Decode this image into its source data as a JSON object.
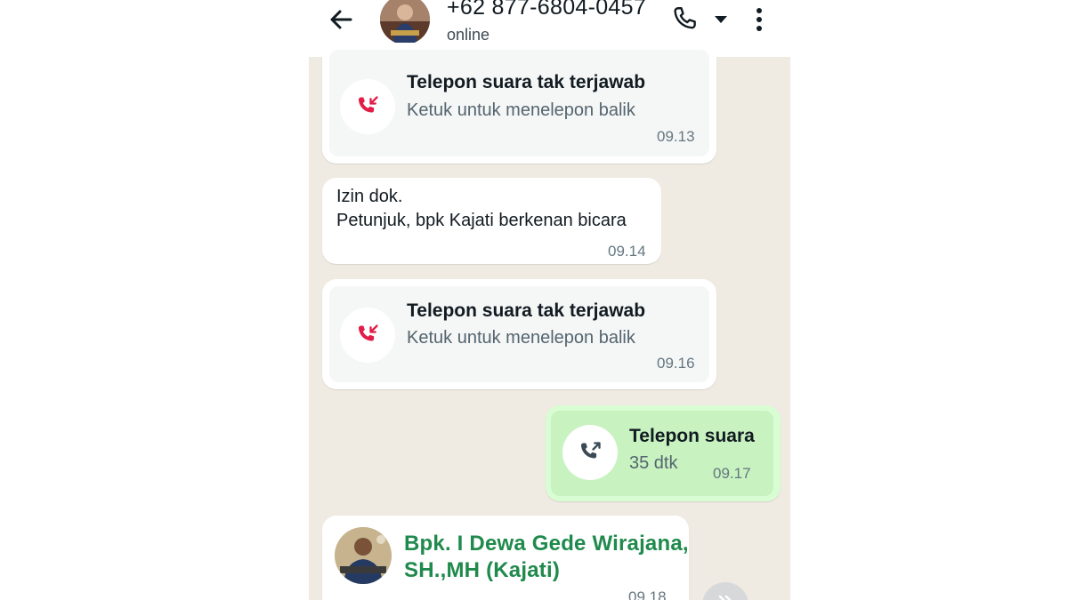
{
  "header": {
    "contact_name": "+62 877-6804-0457",
    "status": "online"
  },
  "messages": [
    {
      "kind": "missed-call",
      "title": "Telepon suara tak terjawab",
      "subtitle": "Ketuk untuk menelepon balik",
      "time": "09.13"
    },
    {
      "kind": "text",
      "lines": [
        "Izin dok.",
        "Petunjuk, bpk Kajati berkenan bicara"
      ],
      "time": "09.14"
    },
    {
      "kind": "missed-call",
      "title": "Telepon suara tak terjawab",
      "subtitle": "Ketuk untuk menelepon balik",
      "time": "09.16"
    },
    {
      "kind": "outgoing-call",
      "title": "Telepon suara",
      "subtitle": "35 dtk",
      "time": "09.17"
    },
    {
      "kind": "contact-card",
      "name_lines": [
        "Bpk. I Dewa Gede Wirajana,",
        "SH.,MH (Kajati)"
      ],
      "time": "09.18"
    }
  ],
  "colors": {
    "chat_background": "#efeae2",
    "incoming_bubble": "#ffffff",
    "outgoing_bubble": "#d9fdd3",
    "missed_call_icon": "#e11d48",
    "contact_name": "#1f8a4c"
  },
  "icons": {
    "back": "arrow-left-icon",
    "call": "phone-icon",
    "caret": "caret-down-icon",
    "menu": "more-vertical-icon",
    "missed_call": "missed-call-icon",
    "outgoing_call": "outgoing-call-icon",
    "scroll": "chevron-double-down-icon"
  }
}
